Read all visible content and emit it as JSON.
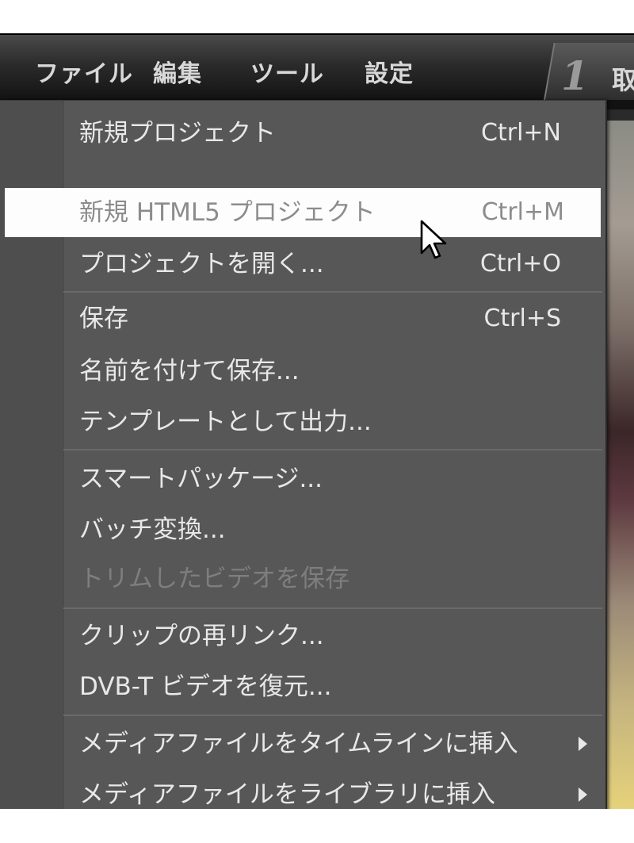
{
  "menubar": {
    "items": [
      "ファイル",
      "編集",
      "ツール",
      "設定"
    ],
    "step_number": "1",
    "step_label": "取"
  },
  "file_menu": {
    "items": [
      {
        "label": "新規プロジェクト",
        "shortcut": "Ctrl+N"
      },
      {
        "label": "新規 HTML5 プロジェクト",
        "shortcut": "Ctrl+M",
        "state": "highlighted"
      },
      {
        "label": "プロジェクトを開く...",
        "shortcut": "Ctrl+O"
      },
      {
        "label": "保存",
        "shortcut": "Ctrl+S"
      },
      {
        "label": "名前を付けて保存..."
      },
      {
        "label": "テンプレートとして出力..."
      },
      {
        "label": "スマートパッケージ..."
      },
      {
        "label": "バッチ変換..."
      },
      {
        "label": "トリムしたビデオを保存",
        "state": "disabled"
      },
      {
        "label": "クリップの再リンク..."
      },
      {
        "label": "DVB-T ビデオを復元..."
      },
      {
        "label": "メディアファイルをタイムラインに挿入",
        "submenu": true
      },
      {
        "label": "メディアファイルをライブラリに挿入",
        "submenu": true
      }
    ]
  },
  "icons": {
    "cursor": "mouse-pointer-icon",
    "submenu": "triangle-right-icon"
  }
}
